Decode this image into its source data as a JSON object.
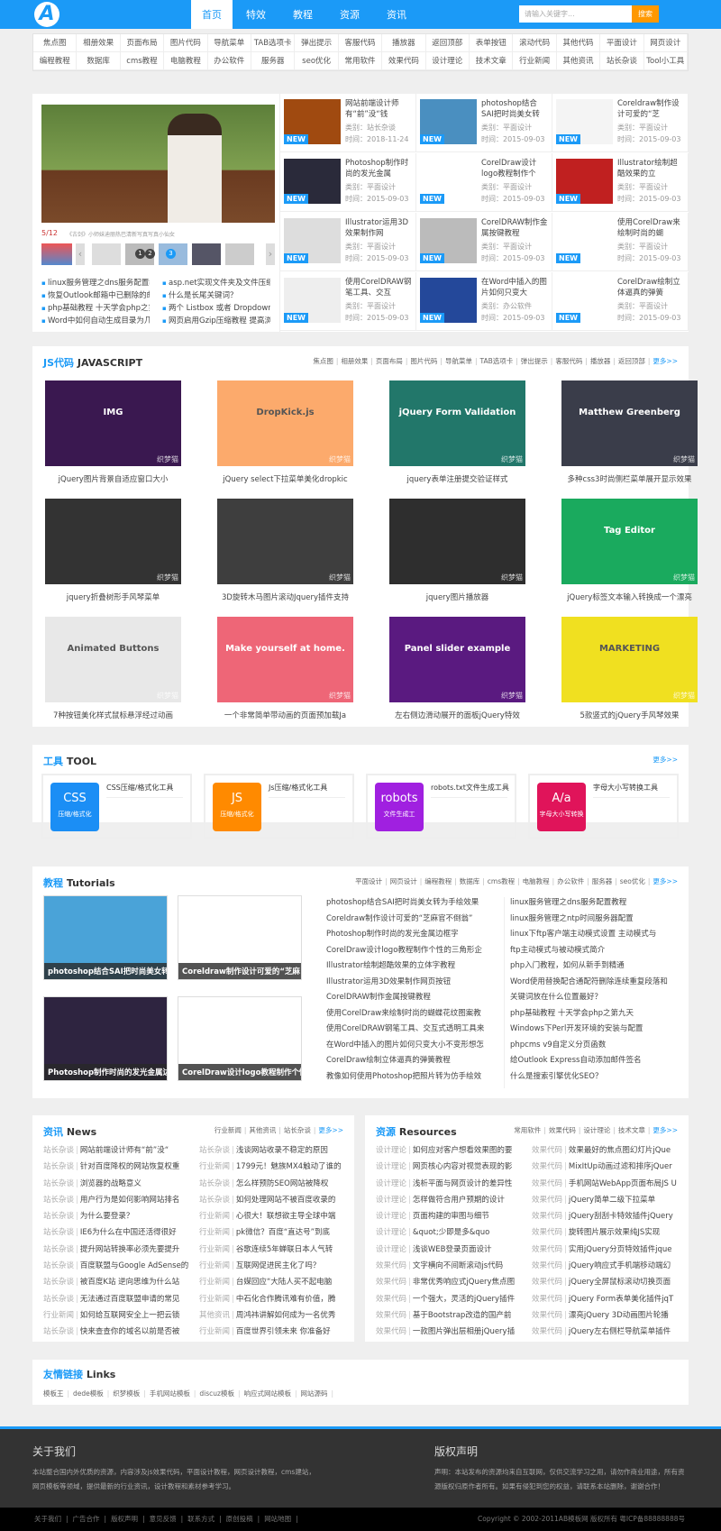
{
  "header": {
    "logo": "A",
    "nav": [
      "首页",
      "特效",
      "教程",
      "资源",
      "资讯"
    ],
    "active": 0,
    "search_placeholder": "请输入关键字...",
    "search_button": "搜索"
  },
  "subnav": [
    "焦点图",
    "相册效果",
    "页面布局",
    "图片代码",
    "导航菜单",
    "TAB选项卡",
    "弹出提示",
    "客服代码",
    "播放器",
    "返回顶部",
    "表单按钮",
    "滚动代码",
    "其他代码",
    "平面设计",
    "网页设计",
    "编程教程",
    "数据库",
    "cms教程",
    "电脑教程",
    "办公软件",
    "服务器",
    "seo优化",
    "常用软件",
    "效果代码",
    "设计理论",
    "技术文章",
    "行业新闻",
    "其他资讯",
    "站长杂谈",
    "Tool小工具"
  ],
  "featured": {
    "slide_counter": "5/12",
    "slide_caption": "《古剑》小师妹迪丽热巴清新写真写真小仙女",
    "thumb_numbers": [
      "1",
      "2",
      "3"
    ],
    "links_left": [
      "linux服务管理之dns服务配置教",
      "恢复Outlook邮箱中已删除的邮",
      "php基础教程 十天学会php之第",
      "Word中如何自动生成目录为几十"
    ],
    "links_right": [
      "asp.net实现文件夹及文件压缩",
      "什么是长尾关键词？",
      "两个 Listbox 或者 DropdownLi",
      "网页启用Gzip压缩教程 提高浏"
    ],
    "new_badge": "NEW",
    "items": [
      {
        "title": "网站前端设计师有“前”没“钱",
        "category": "类别：站长杂谈",
        "time": "时间：2018-11-24"
      },
      {
        "title": "photoshop结合SAI把时尚美女转",
        "category": "类别：平面设计",
        "time": "时间：2015-09-03"
      },
      {
        "title": "Coreldraw制作设计可爱的“芝",
        "category": "类别：平面设计",
        "time": "时间：2015-09-03"
      },
      {
        "title": "Photoshop制作时尚的发光金属",
        "category": "类别：平面设计",
        "time": "时间：2015-09-03"
      },
      {
        "title": "CorelDraw设计logo教程制作个",
        "category": "类别：平面设计",
        "time": "时间：2015-09-03"
      },
      {
        "title": "Illustrator绘制超酷效果的立",
        "category": "类别：平面设计",
        "time": "时间：2015-09-03"
      },
      {
        "title": "Illustrator运用3D效果制作网",
        "category": "类别：平面设计",
        "time": "时间：2015-09-03"
      },
      {
        "title": "CorelDRAW制作金属按键教程",
        "category": "类别：平面设计",
        "time": "时间：2015-09-03"
      },
      {
        "title": "使用CorelDraw来绘制时尚的蝴",
        "category": "类别：平面设计",
        "time": "时间：2015-09-03"
      },
      {
        "title": "使用CorelDRAW钢笔工具、交互",
        "category": "类别：平面设计",
        "time": "时间：2015-09-03"
      },
      {
        "title": "在Word中插入的图片如何只变大",
        "category": "类别：办公软件",
        "time": "时间：2015-09-03"
      },
      {
        "title": "CorelDraw绘制立体逼真的弹簧",
        "category": "类别：平面设计",
        "time": "时间：2015-09-03"
      }
    ]
  },
  "js": {
    "title_cn": "JS代码",
    "title_en": "JAVASCRIPT",
    "links": [
      "焦点图",
      "相册效果",
      "页面布局",
      "图片代码",
      "导航菜单",
      "TAB选项卡",
      "弹出提示",
      "客服代码",
      "播放器",
      "返回顶部"
    ],
    "more": "更多>>",
    "watermark": "织梦猫",
    "items": [
      {
        "caption": "jQuery图片背景自适应窗口大小",
        "color": "#3a1850",
        "label": "IMG"
      },
      {
        "caption": "jQuery select下拉菜单美化dropkic",
        "color": "#fcaa6c",
        "label": "DropKick.js"
      },
      {
        "caption": "jquery表单注册提交验证样式",
        "color": "#22776a",
        "label": "jQuery Form Validation"
      },
      {
        "caption": "多种css3时尚侧栏菜单展开显示效果",
        "color": "#3a3d4a",
        "label": "Matthew Greenberg"
      },
      {
        "caption": "jquery折叠树形手风琴菜单",
        "color": "#333333",
        "label": ""
      },
      {
        "caption": "3D旋转木马图片滚动Jquery插件支持",
        "color": "#3e3e3e",
        "label": ""
      },
      {
        "caption": "jquery图片播放器",
        "color": "#2e2e2e",
        "label": ""
      },
      {
        "caption": "jQuery标签文本输入转换成一个漂亮",
        "color": "#1aaa5e",
        "label": "Tag Editor"
      },
      {
        "caption": "7种按钮美化样式鼠标悬浮经过动画",
        "color": "#e8e8e8",
        "label": "Animated Buttons"
      },
      {
        "caption": "一个非常简单带动画的页面预加载Ja",
        "color": "#ee6677",
        "label": "Make yourself at home."
      },
      {
        "caption": "左右侧边滑动展开的面板jQuery特效",
        "color": "#5a1a80",
        "label": "Panel slider example"
      },
      {
        "caption": "5款竖式的jQuery手风琴效果",
        "color": "#f0e020",
        "label": "MARKETING"
      }
    ]
  },
  "tools": {
    "title_cn": "工具",
    "title_en": "TOOL",
    "more": "更多>>",
    "items": [
      {
        "icon_main": "CSS",
        "icon_sub": "压缩/格式化",
        "name": "CSS压缩/格式化工具",
        "color": "#1b8ef5"
      },
      {
        "icon_main": "JS",
        "icon_sub": "压缩/格式化",
        "name": "Js压缩/格式化工具",
        "color": "#ff8a00"
      },
      {
        "icon_main": "robots",
        "icon_sub": "文件生成工",
        "name": "robots.txt文件生成工具",
        "color": "#a020e0"
      },
      {
        "icon_main": "A/a",
        "icon_sub": "字母大小写转换",
        "name": "字母大小写转换工具",
        "color": "#e0145a"
      }
    ]
  },
  "tutorials": {
    "title_cn": "教程",
    "title_en": "Tutorials",
    "links": [
      "平面设计",
      "网页设计",
      "编程教程",
      "数据库",
      "cms教程",
      "电脑教程",
      "办公软件",
      "服务器",
      "seo优化"
    ],
    "more": "更多>>",
    "images": [
      {
        "caption": "photoshop结合SAI把时尚美女转为",
        "color": "#4aa3d8"
      },
      {
        "caption": "Coreldraw制作设计可爱的“芝麻",
        "color": "#ffffff"
      },
      {
        "caption": "Photoshop制作时尚的发光金属边",
        "color": "#2e2440"
      },
      {
        "caption": "CorelDraw设计logo教程制作个性",
        "color": "#ffffff"
      }
    ],
    "list_left": [
      "photoshop结合SAI把时尚美女转为手绘效果",
      "Coreldraw制作设计可爱的“芝麻官不倒翁”",
      "Photoshop制作时尚的发光金属边框字",
      "CorelDraw设计logo教程制作个性的三角形企",
      "Illustrator绘制超酷效果的立体字教程",
      "Illustrator运用3D效果制作网页按钮",
      "CorelDRAW制作金属按键教程",
      "使用CorelDraw来绘制时尚的蝴蝶花纹图案教",
      "使用CorelDRAW钢笔工具、交互式透明工具来",
      "在Word中插入的图片如何只变大小不变形想怎",
      "CorelDraw绘制立体逼真的弹簧教程",
      "教像如何使用Photoshop把照片转为仿手绘效"
    ],
    "list_right": [
      "linux服务管理之dns服务配置教程",
      "linux服务管理之ntp时间服务器配置",
      "linux下ftp客户端主动模式设置 主动模式与",
      "ftp主动模式与被动模式简介",
      "php入门教程，如何从新手到精通",
      "Word使用替换配合通配符删除连续重复段落和",
      "关键词放在什么位置最好？",
      "php基础教程 十天学会php之第九天",
      "Windows下Perl开发环境的安装与配置",
      "phpcms v9自定义分页函数",
      "给Outlook Express自动添加邮件签名",
      "什么是搜索引擎优化SEO？"
    ]
  },
  "news": {
    "title_cn": "资讯",
    "title_en": "News",
    "links": [
      "行业新闻",
      "其他资讯",
      "站长杂谈"
    ],
    "more": "更多>>",
    "left": [
      [
        "站长杂谈",
        "网站前端设计师有“前”没“"
      ],
      [
        "站长杂谈",
        "针对百度降权的网站恢复权重"
      ],
      [
        "站长杂谈",
        "浏览器的战略意义"
      ],
      [
        "站长杂谈",
        "用户行为是如何影响网站排名"
      ],
      [
        "站长杂谈",
        "为什么要登录？"
      ],
      [
        "站长杂谈",
        "IE6为什么在中国还活得很好"
      ],
      [
        "站长杂谈",
        "提升网站转换率必须先要提升"
      ],
      [
        "站长杂谈",
        "百度联盟与Google AdSense的"
      ],
      [
        "站长杂谈",
        "被百度K站 逆向思维为什么站"
      ],
      [
        "站长杂谈",
        "无法通过百度联盟申请的常见"
      ],
      [
        "行业新闻",
        "如何给互联网安全上一把云锁"
      ],
      [
        "站长杂谈",
        "快来查查你的域名以前是否被"
      ]
    ],
    "right": [
      [
        "站长杂谈",
        "浅谈网站收录不稳定的原因"
      ],
      [
        "行业新闻",
        "1799元！魅族MX4触动了谁的"
      ],
      [
        "站长杂谈",
        "怎么样预防SEO网站被降权"
      ],
      [
        "站长杂谈",
        "如何处理网站不被百度收录的"
      ],
      [
        "行业新闻",
        "心很大！联想欲主导全球中端"
      ],
      [
        "行业新闻",
        "pk微信？百度“直达号”到底"
      ],
      [
        "行业新闻",
        "谷歌连续5年蝉联日本人气转"
      ],
      [
        "行业新闻",
        "互联网促进民主化了吗？"
      ],
      [
        "行业新闻",
        "台媒回应“大陆人买不起电脑"
      ],
      [
        "行业新闻",
        "中石化合作腾讯难有价值，腾"
      ],
      [
        "其他资讯",
        "周鸿祎讲解如何成为一名优秀"
      ],
      [
        "行业新闻",
        "百度世界引领未来 你准备好"
      ]
    ]
  },
  "resources": {
    "title_cn": "资源",
    "title_en": "Resources",
    "links": [
      "常用软件",
      "效果代码",
      "设计理论",
      "技术文章"
    ],
    "more": "更多>>",
    "left": [
      [
        "设计理论",
        "如何应对客户想看效果图的要"
      ],
      [
        "设计理论",
        "网页核心内容对视觉表现的影"
      ],
      [
        "设计理论",
        "浅析平面与网页设计的差异性"
      ],
      [
        "设计理论",
        "怎样做符合用户预期的设计"
      ],
      [
        "设计理论",
        "页面构建的审图与细节"
      ],
      [
        "设计理论",
        "&quot;少即是多&quo"
      ],
      [
        "设计理论",
        "浅谈WEB登录页面设计"
      ],
      [
        "效果代码",
        "文字横向不间断滚动js代码"
      ],
      [
        "效果代码",
        "非常优秀响应式jQuery焦点图"
      ],
      [
        "效果代码",
        "一个强大，灵活的jQuery插件"
      ],
      [
        "效果代码",
        "基于Bootstrap改造的国产前"
      ],
      [
        "效果代码",
        "一款图片弹出层相册jQuery插"
      ]
    ],
    "right": [
      [
        "效果代码",
        "效果最好的焦点图幻灯片jQue"
      ],
      [
        "效果代码",
        "MixItUp动画过滤和排序jQuer"
      ],
      [
        "效果代码",
        "手机网站WebApp页面布局JS U"
      ],
      [
        "效果代码",
        "jQuery简单二级下拉菜单"
      ],
      [
        "效果代码",
        "jQuery刮刮卡特效插件jQuery"
      ],
      [
        "效果代码",
        "旋转图片展示效果纯JS实现"
      ],
      [
        "效果代码",
        "实用jQuery分页特效插件jque"
      ],
      [
        "效果代码",
        "jQuery响应式手机端移动端幻"
      ],
      [
        "效果代码",
        "jQuery全屏鼠标滚动切换页面"
      ],
      [
        "效果代码",
        "jQuery Form表单美化插件jqT"
      ],
      [
        "效果代码",
        "漂亮jQuery 3D动画图片轮播"
      ],
      [
        "效果代码",
        "jQuery左右侧栏导航菜单插件"
      ]
    ]
  },
  "links": {
    "title_cn": "友情链接",
    "title_en": "Links",
    "items": [
      "模板王",
      "dede模板",
      "织梦模板",
      "手机网站模板",
      "discuz模板",
      "响应式网站模板",
      "网站源码"
    ]
  },
  "footer": {
    "about_title": "关于我们",
    "about_text": "本站整合国内外优质的资源，内容涉及js效果代码，平面设计教程，网页设计教程，cms建站，网页模板等领域，提供最新的行业资讯，设计教程和素材参考学习。",
    "copyright_title": "版权声明",
    "copyright_text": "声明：本站发布的资源均来自互联网，仅供交流学习之用，请勿作商业用途，所有资源版权归原作者所有。如果有侵犯到您的权益，请联系本站删除，谢谢合作！",
    "bottom_links": [
      "关于我们",
      "广告合作",
      "版权声明",
      "意见反馈",
      "联系方式",
      "原创投稿",
      "网站地图"
    ],
    "copyright": "Copyright © 2002-2011AB模板网 版权所有  粤ICP备88888888号"
  },
  "colors": {
    "accent": "#1b9af7",
    "search_button": "#ff9800",
    "footer": "#333333"
  }
}
